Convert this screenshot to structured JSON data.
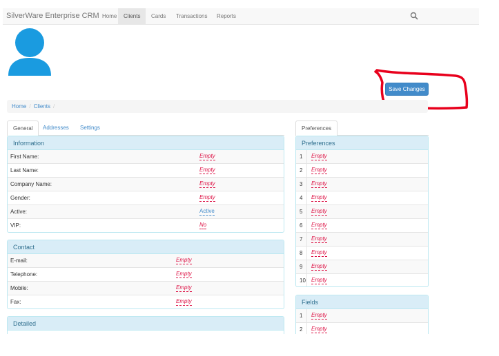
{
  "navbar": {
    "brand": "SilverWare Enterprise CRM",
    "items": [
      {
        "label": "Home"
      },
      {
        "label": "Clients",
        "active": true
      },
      {
        "label": "Cards"
      },
      {
        "label": "Transactions"
      },
      {
        "label": "Reports"
      }
    ],
    "search_icon": "search-icon"
  },
  "toolbar": {
    "save_label": "Save Changes"
  },
  "breadcrumb": {
    "home": "Home",
    "clients": "Clients",
    "sep": "/"
  },
  "tabs": [
    {
      "label": "General",
      "active": true
    },
    {
      "label": "Addresses"
    },
    {
      "label": "Settings"
    }
  ],
  "right_tabs": [
    {
      "label": "Preferences",
      "active": true
    }
  ],
  "information": {
    "title": "Information",
    "rows": [
      {
        "label": "First Name:",
        "value": "Empty"
      },
      {
        "label": "Last Name:",
        "value": "Empty"
      },
      {
        "label": "Company Name:",
        "value": "Empty"
      },
      {
        "label": "Gender:",
        "value": "Empty"
      },
      {
        "label": "Active:",
        "value": "Active"
      },
      {
        "label": "VIP:",
        "value": "No"
      }
    ]
  },
  "contact": {
    "title": "Contact",
    "rows": [
      {
        "label": "E-mail:",
        "value": "Empty"
      },
      {
        "label": "Telephone:",
        "value": "Empty"
      },
      {
        "label": "Mobile:",
        "value": "Empty"
      },
      {
        "label": "Fax:",
        "value": "Empty"
      }
    ]
  },
  "detailed": {
    "title": "Detailed"
  },
  "preferences": {
    "title": "Preferences",
    "rows": [
      {
        "num": "1",
        "value": "Empty"
      },
      {
        "num": "2",
        "value": "Empty"
      },
      {
        "num": "3",
        "value": "Empty"
      },
      {
        "num": "4",
        "value": "Empty"
      },
      {
        "num": "5",
        "value": "Empty"
      },
      {
        "num": "6",
        "value": "Empty"
      },
      {
        "num": "7",
        "value": "Empty"
      },
      {
        "num": "8",
        "value": "Empty"
      },
      {
        "num": "9",
        "value": "Empty"
      },
      {
        "num": "10",
        "value": "Empty"
      }
    ]
  },
  "fields": {
    "title": "Fields",
    "rows": [
      {
        "num": "1",
        "value": "Empty"
      },
      {
        "num": "2",
        "value": "Empty"
      }
    ]
  },
  "colors": {
    "accent": "#428bca",
    "empty_value": "#dd1144",
    "panel_heading": "#d9edf7",
    "annotation": "#e8001c",
    "avatar": "#1a9be0"
  }
}
